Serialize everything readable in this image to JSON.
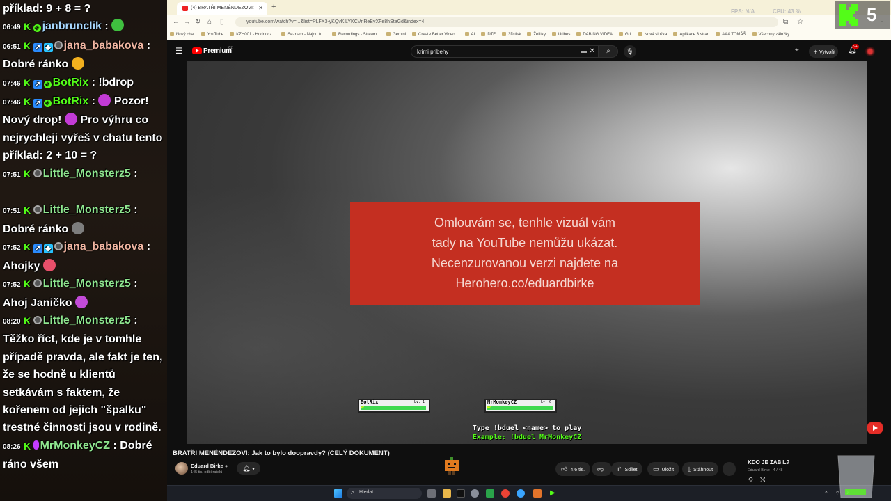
{
  "chat": {
    "lines": [
      {
        "pre": "",
        "user": "",
        "sep": "",
        "text": "příklad: 9 + 8 = ?",
        "badges": [],
        "user_color": "#ffffff"
      },
      {
        "pre": "06:49",
        "user": "janbrunclik",
        "sep": " :",
        "text": "",
        "badges": [
          "kick",
          "check"
        ],
        "user_color": "#a8d8ff",
        "emote": "green-ball"
      },
      {
        "pre": "06:51",
        "user": "jana_babakova",
        "sep": " :",
        "text": "",
        "badges": [
          "kick",
          "blue",
          "cube",
          "ring"
        ],
        "user_color": "#f2b6a2"
      },
      {
        "pre": "",
        "user": "",
        "sep": "",
        "text": "Dobré ránko",
        "badges": [],
        "user_color": "#ffffff",
        "emote": "sun"
      },
      {
        "pre": "07:46",
        "user": "BotRix",
        "sep": " :",
        "text": "!bdrop",
        "badges": [
          "kick",
          "blue",
          "check"
        ],
        "user_color": "#53fc18"
      },
      {
        "pre": "07:46",
        "user": "BotRix",
        "sep": " :",
        "text": "Pozor!",
        "badges": [
          "kick",
          "blue",
          "check"
        ],
        "user_color": "#53fc18",
        "emote": "bars"
      },
      {
        "pre": "",
        "user": "",
        "sep": "",
        "text": "Nový drop!",
        "badges": [],
        "user_color": "#ffffff",
        "emote": "bars",
        "text2": "Pro výhru co"
      },
      {
        "pre": "",
        "user": "",
        "sep": "",
        "text": "nejrychleji vyřeš v chatu tento",
        "badges": [],
        "user_color": "#ffffff"
      },
      {
        "pre": "",
        "user": "",
        "sep": "",
        "text": "příklad: 2 + 10 = ?",
        "badges": [],
        "user_color": "#ffffff"
      },
      {
        "pre": "07:51",
        "user": "Little_Monsterz5",
        "sep": " :",
        "text": "",
        "badges": [
          "kick",
          "ring"
        ],
        "user_color": "#8fe68f"
      },
      {
        "pre": "",
        "user": "",
        "sep": "",
        "text": "",
        "badges": [],
        "user_color": "#ffffff"
      },
      {
        "pre": "07:51",
        "user": "Little_Monsterz5",
        "sep": " :",
        "text": "",
        "badges": [
          "kick",
          "ring"
        ],
        "user_color": "#8fe68f"
      },
      {
        "pre": "",
        "user": "",
        "sep": "",
        "text": "Dobré ránko",
        "badges": [],
        "user_color": "#ffffff",
        "emote": "ball"
      },
      {
        "pre": "07:52",
        "user": "jana_babakova",
        "sep": " :",
        "text": "",
        "badges": [
          "kick",
          "blue",
          "cube",
          "ring"
        ],
        "user_color": "#f2b6a2"
      },
      {
        "pre": "",
        "user": "",
        "sep": "",
        "text": "Ahojky",
        "badges": [],
        "user_color": "#ffffff",
        "emote": "party"
      },
      {
        "pre": "07:52",
        "user": "Little_Monsterz5",
        "sep": " :",
        "text": "",
        "badges": [
          "kick",
          "ring"
        ],
        "user_color": "#8fe68f"
      },
      {
        "pre": "",
        "user": "",
        "sep": "",
        "text": "Ahoj Janičko",
        "badges": [],
        "user_color": "#ffffff",
        "emote": "heart"
      },
      {
        "pre": "08:20",
        "user": "Little_Monsterz5",
        "sep": " :",
        "text": "",
        "badges": [
          "kick",
          "ring"
        ],
        "user_color": "#8fe68f"
      },
      {
        "pre": "",
        "user": "",
        "sep": "",
        "text": "Těžko říct, kde je v tomhle",
        "badges": [],
        "user_color": "#ffffff"
      },
      {
        "pre": "",
        "user": "",
        "sep": "",
        "text": "případě pravda, ale fakt je ten,",
        "badges": [],
        "user_color": "#ffffff"
      },
      {
        "pre": "",
        "user": "",
        "sep": "",
        "text": "že se hodně u klientů",
        "badges": [],
        "user_color": "#ffffff"
      },
      {
        "pre": "",
        "user": "",
        "sep": "",
        "text": "setkávám s faktem, že",
        "badges": [],
        "user_color": "#ffffff"
      },
      {
        "pre": "",
        "user": "",
        "sep": "",
        "text": "kořenem od jejich \"špalku\"",
        "badges": [],
        "user_color": "#ffffff"
      },
      {
        "pre": "",
        "user": "",
        "sep": "",
        "text": "trestné činnosti jsou v rodině.",
        "badges": [],
        "user_color": "#ffffff"
      },
      {
        "pre": "08:26",
        "user": "MrMonkeyCZ",
        "sep": " :",
        "text": "Dobré",
        "badges": [
          "kick",
          "mic"
        ],
        "user_color": "#8fe68f"
      },
      {
        "pre": "",
        "user": "",
        "sep": "",
        "text": "ráno všem",
        "badges": [],
        "user_color": "#ffffff"
      }
    ]
  },
  "browser": {
    "tab_title": "(4) BRATŘI MENÉNDEZOVI:",
    "url": "youtube.com/watch?v=...&list=PLFX3-yKQvKlLYKCVnReByXFe8hStaGd&index=4",
    "bookmarks": [
      "Nový chat",
      "YouTube",
      "KZH001 - Hodnocz...",
      "Seznam - Najdu tu...",
      "Recordings - Stream...",
      "Gemini",
      "Create Better Video...",
      "AI",
      "DTF",
      "3D tisk",
      "Želítky",
      "Uribes",
      "DABING VIDEA",
      "Grit",
      "Nová složka",
      "Aplikace 3 stran",
      "AAA TOMÁŠ",
      "Všechny záložky"
    ]
  },
  "youtube": {
    "brand": "Premium",
    "brand_region": "CZ",
    "search_value": "krimi pribehy",
    "create_label": "Vytvořit",
    "notif_count": "9+",
    "notice_lines": [
      "Omlouvám se, tenhle vizuál vám",
      "tady na YouTube nemůžu ukázat.",
      "Necenzurovanou verzi najdete na",
      "Herohero.co/eduardbirke"
    ],
    "duel": {
      "player1": "BotRix",
      "player1_lv": "Lv. 1",
      "player1_hp": 1.0,
      "player2": "MrMonkeyCZ",
      "player2_lv": "Lv. 6",
      "player2_hp": 1.0,
      "hp_label": "HP",
      "line1": "Type !bduel <name> to play",
      "line2": "Example: !bduel MrMonkeyCZ"
    },
    "video_title": "BRATŘI MENÉNDEZOVI: Jak to bylo doopravdy? (CELÝ DOKUMENT)",
    "channel_name": "Eduard Birke",
    "channel_subs": "145 tis. odběratelů",
    "likes": "4,6 tis.",
    "share_label": "Sdílet",
    "save_label": "Uložit",
    "download_label": "Stáhnout",
    "playlist_title": "KDO JE ZABIL?",
    "playlist_sub": "Eduard Birke - 4 / 48"
  },
  "taskbar": {
    "search_placeholder": "Hledat"
  },
  "overlay": {
    "fps_label": "FPS: N/A",
    "cpu_label": "CPU: 43 %",
    "kick_number": "5"
  },
  "colors": {
    "kick_green": "#53fc18",
    "notice_red": "#c42f21",
    "yt_red": "#ff0000"
  }
}
